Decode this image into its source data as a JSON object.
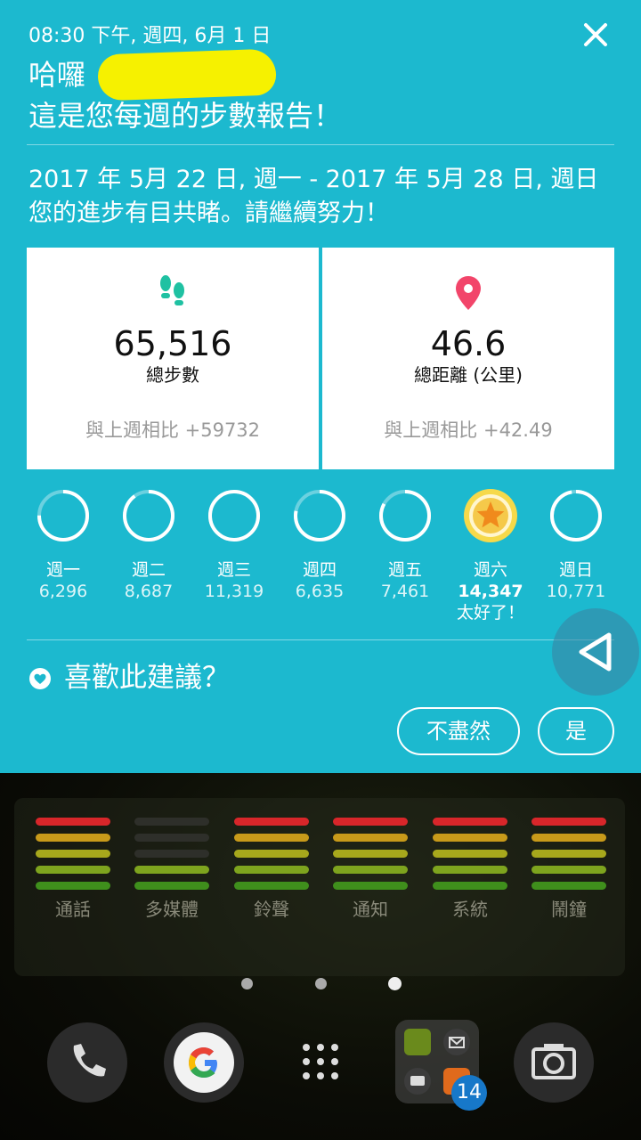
{
  "notification": {
    "timestamp": "08:30 下午, 週四, 6月 1 日",
    "greeting": "哈囉",
    "subtitle": "這是您每週的步數報告！",
    "date_range": "2017 年 5月 22 日, 週一 - 2017 年 5月 28 日, 週日",
    "progress_text": "您的進步有目共睹。請繼續努力！",
    "close_icon": "close-icon",
    "steps": {
      "icon": "footsteps-icon",
      "value": "65,516",
      "label": "總步數",
      "compare": "與上週相比 +59732"
    },
    "distance": {
      "icon": "location-pin-icon",
      "value": "46.6",
      "label": "總距離 (公里)",
      "compare": "與上週相比 +42.49"
    },
    "days": [
      {
        "name": "週一",
        "steps": "6,296",
        "progress": 0.75
      },
      {
        "name": "週二",
        "steps": "8,687",
        "progress": 0.9
      },
      {
        "name": "週三",
        "steps": "11,319",
        "progress": 1.0
      },
      {
        "name": "週四",
        "steps": "6,635",
        "progress": 0.78
      },
      {
        "name": "週五",
        "steps": "7,461",
        "progress": 0.83
      },
      {
        "name": "週六",
        "steps": "14,347",
        "note": "太好了！",
        "best": true,
        "progress": 1.0
      },
      {
        "name": "週日",
        "steps": "10,771",
        "progress": 0.97
      }
    ],
    "feedback": {
      "question": "喜歡此建議？",
      "no": "不盡然",
      "yes": "是"
    },
    "colors": {
      "background": "#1cb9cf",
      "steps_icon": "#1fc1a2",
      "pin_icon": "#f2456a",
      "star_ring": "#f6d94a",
      "star": "#f08a1c"
    }
  },
  "home": {
    "volume_widget": [
      {
        "label": "通話",
        "levels": 5
      },
      {
        "label": "多媒體",
        "levels": 2
      },
      {
        "label": "鈴聲",
        "levels": 5
      },
      {
        "label": "通知",
        "levels": 5
      },
      {
        "label": "系統",
        "levels": 5
      },
      {
        "label": "鬧鐘",
        "levels": 5
      }
    ],
    "page_indicator": {
      "pages": 3,
      "current": 3
    },
    "dock": [
      {
        "icon": "phone-icon"
      },
      {
        "icon": "google-icon"
      },
      {
        "icon": "app-drawer-icon"
      },
      {
        "icon": "folder-icon",
        "badge": "14"
      },
      {
        "icon": "camera-icon"
      }
    ],
    "nav_overlay": {
      "icon": "back-triangle-icon"
    }
  }
}
